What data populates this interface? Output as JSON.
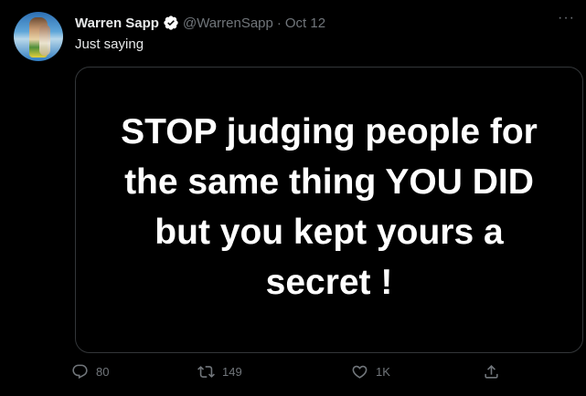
{
  "author": {
    "name": "Warren Sapp",
    "handle": "@WarrenSapp",
    "separator": "·",
    "date": "Oct 12",
    "verified": true
  },
  "tweet": {
    "text": "Just saying",
    "image_text": "STOP judging people for\nthe same thing YOU DID\nbut you kept yours a\nsecret !"
  },
  "actions": {
    "replies": "80",
    "retweets": "149",
    "likes": "1K"
  },
  "colors": {
    "background": "#000000",
    "primary_text": "#e7e9ea",
    "secondary_text": "#71767b",
    "verified_badge": "#ffffff",
    "border": "#333639"
  },
  "icons": [
    "verified-badge-icon",
    "more-options-icon",
    "reply-icon",
    "retweet-icon",
    "like-icon",
    "share-icon"
  ]
}
